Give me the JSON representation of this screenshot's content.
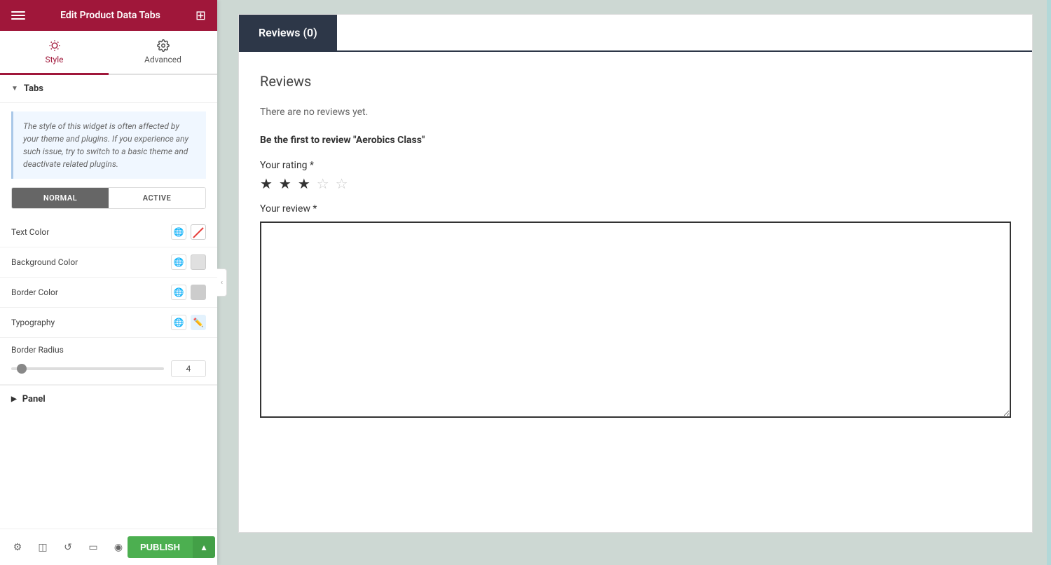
{
  "header": {
    "title": "Edit Product Data Tabs",
    "hamburger_label": "menu",
    "grid_label": "apps"
  },
  "panel_tabs": [
    {
      "id": "style",
      "label": "Style",
      "active": true
    },
    {
      "id": "advanced",
      "label": "Advanced",
      "active": false
    }
  ],
  "tabs_section": {
    "label": "Tabs",
    "collapsed": false,
    "info_text": "The style of this widget is often affected by your theme and plugins. If you experience any such issue, try to switch to a basic theme and deactivate related plugins.",
    "toggle": {
      "options": [
        "NORMAL",
        "ACTIVE"
      ],
      "selected": "NORMAL"
    },
    "properties": [
      {
        "id": "text-color",
        "label": "Text Color",
        "type": "color",
        "swatch_class": "strikethrough",
        "swatch_color": "transparent"
      },
      {
        "id": "background-color",
        "label": "Background Color",
        "type": "color",
        "swatch_color": "#e0e0e0"
      },
      {
        "id": "border-color",
        "label": "Border Color",
        "type": "color",
        "swatch_color": "#cccccc"
      },
      {
        "id": "typography",
        "label": "Typography",
        "type": "typography"
      }
    ],
    "border_radius": {
      "label": "Border Radius",
      "value": 4,
      "min": 0,
      "max": 100
    }
  },
  "panel_section": {
    "label": "Panel",
    "collapsed": true
  },
  "bottom_bar": {
    "publish_label": "PUBLISH",
    "icons": [
      "settings",
      "layers",
      "history",
      "template",
      "eye"
    ]
  },
  "review_tab": {
    "label": "Reviews (0)"
  },
  "review_content": {
    "title": "Reviews",
    "no_reviews": "There are no reviews yet.",
    "be_first": "Be the first to review \"Aerobics Class\"",
    "your_rating_label": "Your rating *",
    "stars_filled": 3,
    "stars_total": 5,
    "your_review_label": "Your review *"
  }
}
